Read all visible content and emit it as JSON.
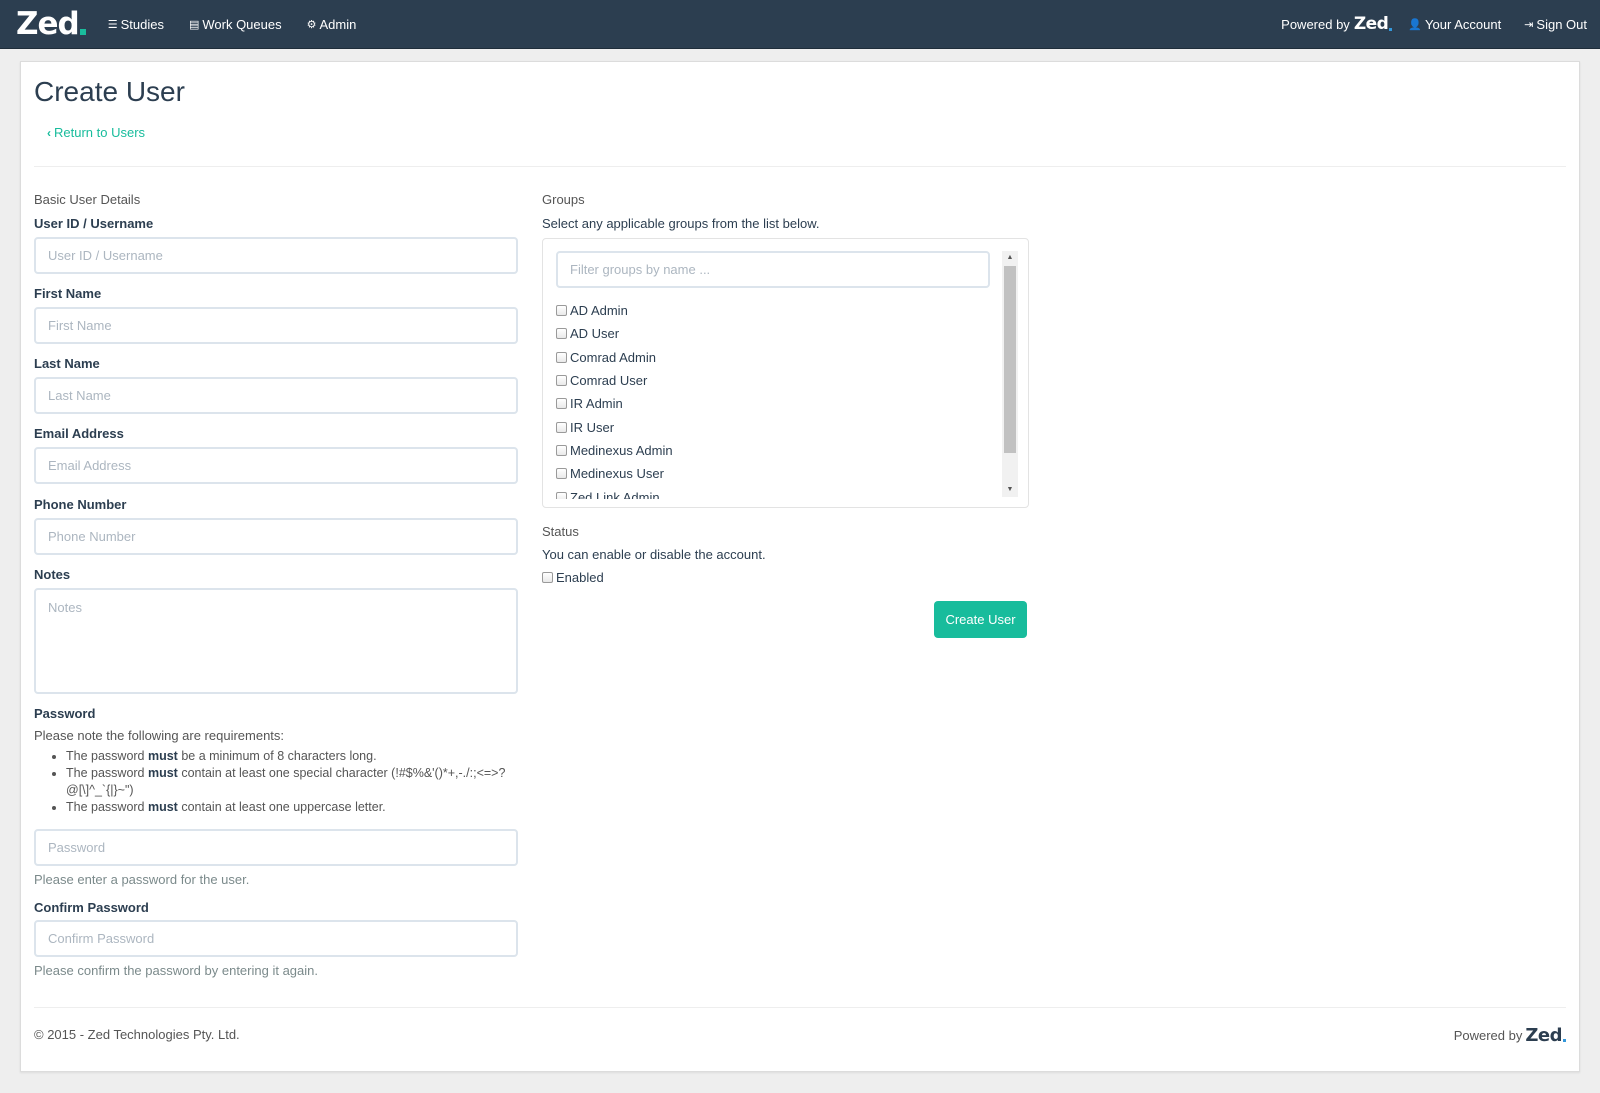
{
  "nav": {
    "brand": "Zed",
    "items": [
      {
        "label": "Studies",
        "icon": "list-icon"
      },
      {
        "label": "Work Queues",
        "icon": "table-icon"
      },
      {
        "label": "Admin",
        "icon": "cogs-icon"
      }
    ],
    "powered_by": "Powered by",
    "powered_brand": "Zed",
    "account": "Your Account",
    "signout": "Sign Out"
  },
  "page": {
    "title": "Create User",
    "back": "Return to Users"
  },
  "basic": {
    "section": "Basic User Details",
    "username": {
      "label": "User ID / Username",
      "placeholder": "User ID / Username"
    },
    "first_name": {
      "label": "First Name",
      "placeholder": "First Name"
    },
    "last_name": {
      "label": "Last Name",
      "placeholder": "Last Name"
    },
    "email": {
      "label": "Email Address",
      "placeholder": "Email Address"
    },
    "phone": {
      "label": "Phone Number",
      "placeholder": "Phone Number"
    },
    "notes": {
      "label": "Notes",
      "placeholder": "Notes"
    }
  },
  "password": {
    "label": "Password",
    "note": "Please note the following are requirements:",
    "rules": [
      {
        "pre": "The password ",
        "strong": "must",
        "post": " be a minimum of 8 characters long."
      },
      {
        "pre": "The password ",
        "strong": "must",
        "post": " contain at least one special character (!#$%&'()*+,-./:;<=>?@[\\]^_`{|}~\")"
      },
      {
        "pre": "The password ",
        "strong": "must",
        "post": " contain at least one uppercase letter."
      }
    ],
    "placeholder": "Password",
    "help": "Please enter a password for the user.",
    "confirm_label": "Confirm Password",
    "confirm_placeholder": "Confirm Password",
    "confirm_help": "Please confirm the password by entering it again."
  },
  "groups": {
    "section": "Groups",
    "desc": "Select any applicable groups from the list below.",
    "filter_placeholder": "Filter groups by name ...",
    "items": [
      "AD Admin",
      "AD User",
      "Comrad Admin",
      "Comrad User",
      "IR Admin",
      "IR User",
      "Medinexus Admin",
      "Medinexus User",
      "Zed Link Admin"
    ]
  },
  "status": {
    "section": "Status",
    "desc": "You can enable or disable the account.",
    "enabled_label": "Enabled"
  },
  "submit_label": "Create User",
  "footer": {
    "copyright": "© 2015 - Zed Technologies Pty. Ltd.",
    "powered_by": "Powered by",
    "powered_brand": "Zed"
  },
  "colors": {
    "navbar": "#2c3e50",
    "accent": "#18bc9c"
  }
}
